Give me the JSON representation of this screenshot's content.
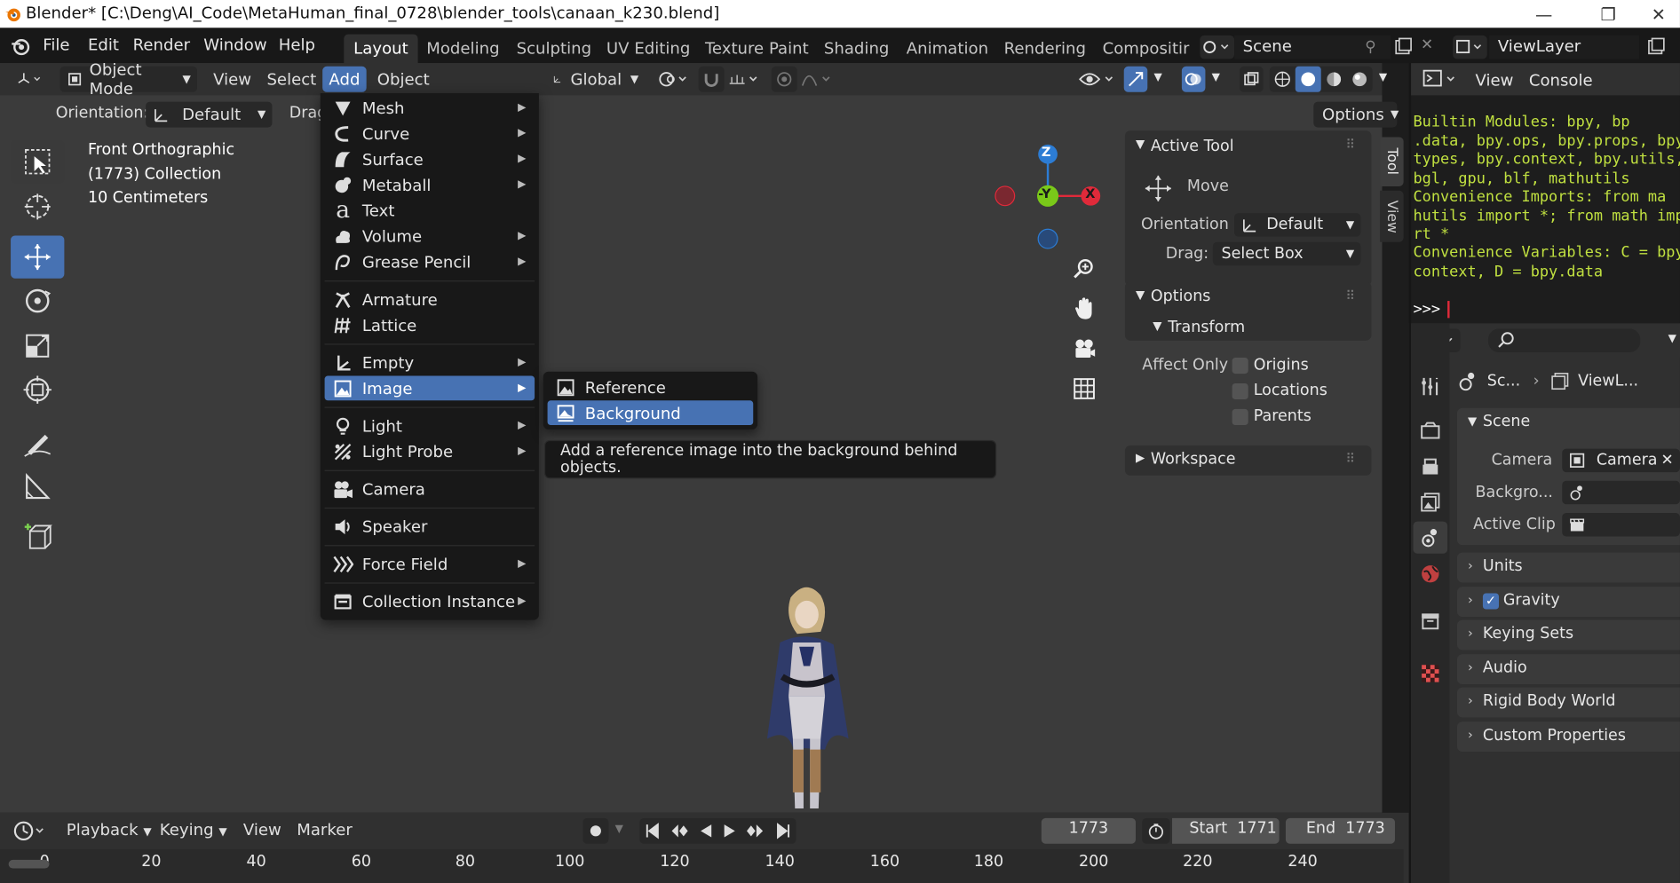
{
  "title_bar": {
    "title": "Blender* [C:\\Deng\\AI_Code\\MetaHuman_final_0728\\blender_tools\\canaan_k230.blend]"
  },
  "menubar": {
    "items": [
      "File",
      "Edit",
      "Render",
      "Window",
      "Help"
    ],
    "workspaces": [
      "Layout",
      "Modeling",
      "Sculpting",
      "UV Editing",
      "Texture Paint",
      "Shading",
      "Animation",
      "Rendering",
      "Compositin"
    ],
    "scene": "Scene",
    "view_layer": "ViewLayer"
  },
  "viewport_header": {
    "mode": "Object Mode",
    "menus": [
      "View",
      "Select",
      "Add",
      "Object"
    ],
    "transform_orientation": "Global",
    "options": "Options"
  },
  "tool_settings": {
    "orientation_label": "Orientation:",
    "orientation_value": "Default",
    "drag_label": "Drag"
  },
  "viewport_info": {
    "view": "Front Orthographic",
    "collection": "(1773) Collection",
    "scale": "10 Centimeters"
  },
  "gizmo": {
    "z": "Z",
    "y": "-Y",
    "x": "X"
  },
  "add_menu": {
    "items": [
      "Mesh",
      "Curve",
      "Surface",
      "Metaball",
      "Text",
      "Volume",
      "Grease Pencil",
      "Armature",
      "Lattice",
      "Empty",
      "Image",
      "Light",
      "Light Probe",
      "Camera",
      "Speaker",
      "Force Field",
      "Collection Instance"
    ],
    "highlighted": "Image"
  },
  "image_submenu": {
    "items": [
      "Reference",
      "Background"
    ],
    "highlighted": "Background"
  },
  "tooltip": "Add a reference image into the background behind objects.",
  "n_panel": {
    "active_tool_title": "Active Tool",
    "tool_name": "Move",
    "orientation_label": "Orientation",
    "orientation_value": "Default",
    "drag_label": "Drag:",
    "drag_value": "Select Box",
    "options_title": "Options",
    "transform_title": "Transform",
    "affect_only": "Affect Only",
    "checkboxes": [
      "Origins",
      "Locations",
      "Parents"
    ],
    "workspace_title": "Workspace",
    "tabs": [
      "Tool",
      "View"
    ]
  },
  "timeline": {
    "menus": [
      "Playback",
      "Keying",
      "View",
      "Marker"
    ],
    "current_frame": "1773",
    "start_label": "Start",
    "start": "1771",
    "end_label": "End",
    "end": "1773",
    "ticks": [
      "0",
      "20",
      "40",
      "60",
      "80",
      "100",
      "120",
      "140",
      "160",
      "180",
      "200",
      "220",
      "240"
    ]
  },
  "console": {
    "menus": [
      "View",
      "Console"
    ],
    "lines": [
      "Builtin Modules:      bpy, bp",
      ".data, bpy.ops, bpy.props, bpy",
      "types, bpy.context, bpy.utils,",
      "bgl, gpu, blf, mathutils",
      "Convenience Imports:   from ma",
      "hutils import *; from math imp",
      "rt *",
      "Convenience Variables: C = bpy",
      "context, D = bpy.data"
    ],
    "prompt": ">>>"
  },
  "properties": {
    "breadcrumb_scene": "Sc...",
    "breadcrumb_layer": "ViewL...",
    "scene_title": "Scene",
    "camera_label": "Camera",
    "camera_value": "Camera",
    "background_label": "Backgro...",
    "active_clip_label": "Active Clip",
    "sections": [
      "Units",
      "Gravity",
      "Keying Sets",
      "Audio",
      "Rigid Body World",
      "Custom Properties"
    ]
  },
  "colors": {
    "accent": "#4772b3",
    "console_text": "#c0e040",
    "axis_x": "#e02a3a",
    "axis_y": "#7ac919",
    "axis_z": "#2c7cd4"
  }
}
